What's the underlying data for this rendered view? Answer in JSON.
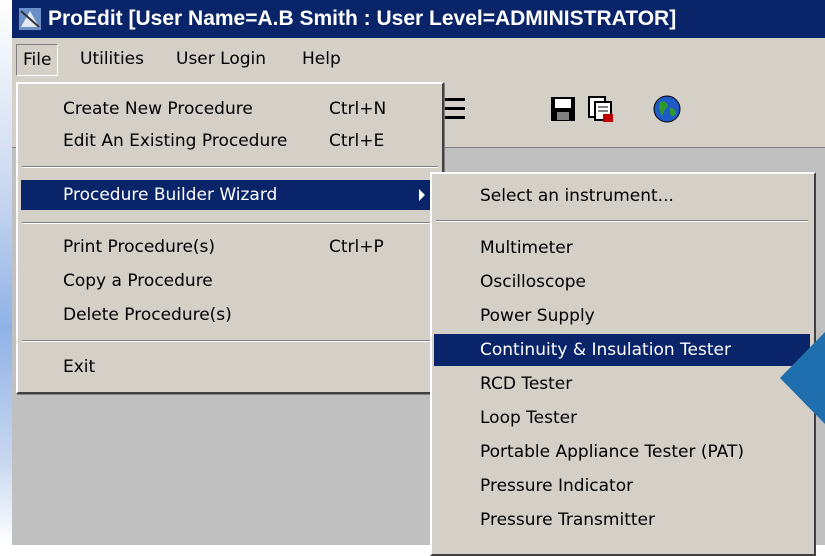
{
  "window": {
    "title": "ProEdit [User Name=A.B Smith : User Level=ADMINISTRATOR]"
  },
  "menubar": {
    "items": [
      {
        "label": "File"
      },
      {
        "label": "Utilities"
      },
      {
        "label": "User Login"
      },
      {
        "label": "Help"
      }
    ]
  },
  "file_menu": {
    "items": [
      {
        "label": "Create New Procedure",
        "shortcut": "Ctrl+N"
      },
      {
        "label": "Edit An Existing Procedure",
        "shortcut": "Ctrl+E"
      },
      {
        "label": "Procedure Builder Wizard",
        "shortcut": ""
      },
      {
        "label": "Print Procedure(s)",
        "shortcut": "Ctrl+P"
      },
      {
        "label": "Copy a Procedure",
        "shortcut": ""
      },
      {
        "label": "Delete Procedure(s)",
        "shortcut": ""
      },
      {
        "label": "Exit",
        "shortcut": ""
      }
    ]
  },
  "wizard_submenu": {
    "header": "Select an instrument...",
    "items": [
      {
        "label": "Multimeter"
      },
      {
        "label": "Oscilloscope"
      },
      {
        "label": "Power Supply"
      },
      {
        "label": "Continuity & Insulation Tester"
      },
      {
        "label": "RCD Tester"
      },
      {
        "label": "Loop Tester"
      },
      {
        "label": "Portable Appliance Tester (PAT)"
      },
      {
        "label": "Pressure Indicator"
      },
      {
        "label": "Pressure Transmitter"
      }
    ],
    "selected": "Continuity & Insulation Tester"
  },
  "toolbar": {
    "icons": [
      "list-icon",
      "save-icon",
      "print-icon",
      "globe-icon"
    ]
  },
  "colors": {
    "highlight": "#0a246a",
    "menu_bg": "#d4d0c8",
    "accent": "#1f6fae"
  }
}
